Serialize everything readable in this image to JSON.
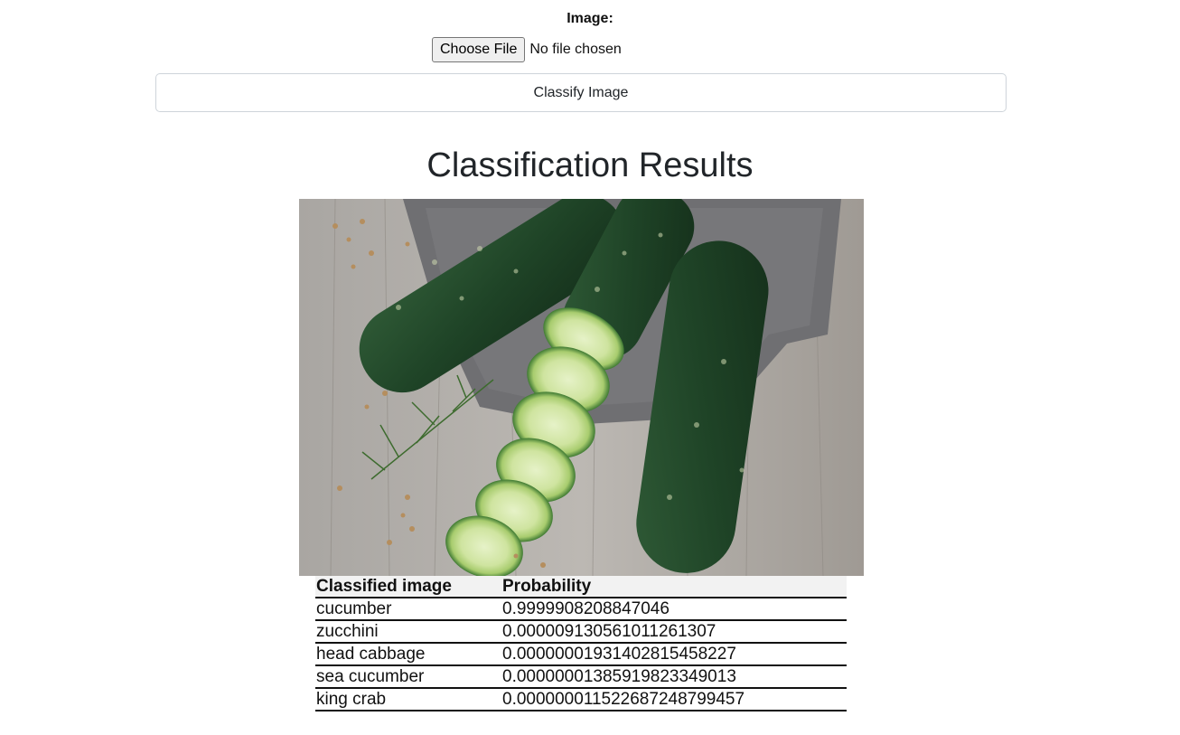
{
  "form": {
    "image_label": "Image:",
    "choose_file_label": "Choose File",
    "file_status": "No file chosen",
    "classify_button_label": "Classify Image"
  },
  "results": {
    "title": "Classification Results",
    "image_alt": "cucumbers",
    "table": {
      "headers": [
        "Classified image",
        "Probability"
      ],
      "rows": [
        {
          "label": "cucumber",
          "probability": "0.9999908208847046"
        },
        {
          "label": "zucchini",
          "probability": "0.000009130561011261307"
        },
        {
          "label": "head cabbage",
          "probability": "0.00000001931402815458227"
        },
        {
          "label": "sea cucumber",
          "probability": "0.00000001385919823349013"
        },
        {
          "label": "king crab",
          "probability": "0.000000011522687248799457"
        }
      ]
    }
  }
}
